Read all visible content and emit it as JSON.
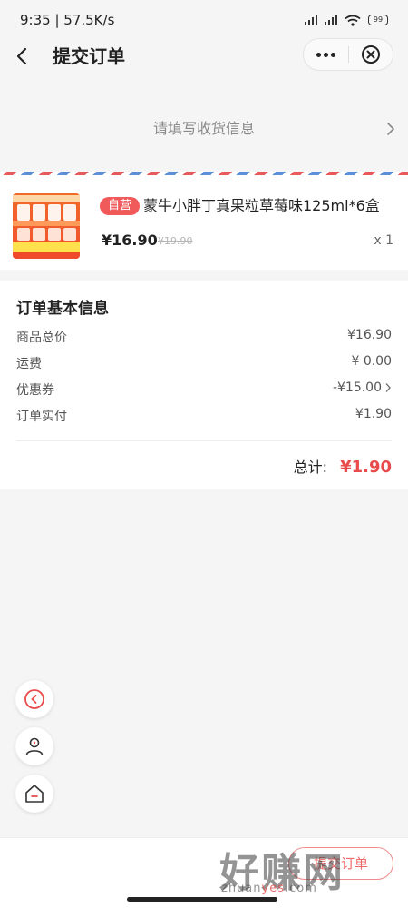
{
  "status_bar": {
    "time_speed": "9:35 | 57.5K/s",
    "battery": "99"
  },
  "header": {
    "title": "提交订单"
  },
  "address": {
    "hint": "请填写收货信息"
  },
  "product": {
    "badge": "自营",
    "name": "蒙牛小胖丁真果粒草莓味125ml*6盒",
    "price": "¥16.90",
    "original_price": "¥19.90",
    "quantity": "x 1"
  },
  "order_info": {
    "title": "订单基本信息",
    "rows": [
      {
        "label": "商品总价",
        "value": "¥16.90"
      },
      {
        "label": "运费",
        "value": "¥ 0.00"
      },
      {
        "label": "优惠券",
        "value": "-¥15.00"
      },
      {
        "label": "订单实付",
        "value": "¥1.90"
      }
    ],
    "total_label": "总计:",
    "total_value": "¥1.90"
  },
  "bottom": {
    "submit_label": "提交订单"
  },
  "watermark": {
    "cn": "好赚网",
    "en_prefix": "zhuan",
    "en_highlight": "yes",
    "en_suffix": ".com"
  },
  "colors": {
    "accent": "#e84b4b",
    "badge": "#f05a5a",
    "stripe_blue": "#5b8fd6"
  },
  "icons": [
    "back-arrow-icon",
    "more-icon",
    "close-icon",
    "chevron-right-icon",
    "back-circle-icon",
    "user-icon",
    "home-icon"
  ]
}
